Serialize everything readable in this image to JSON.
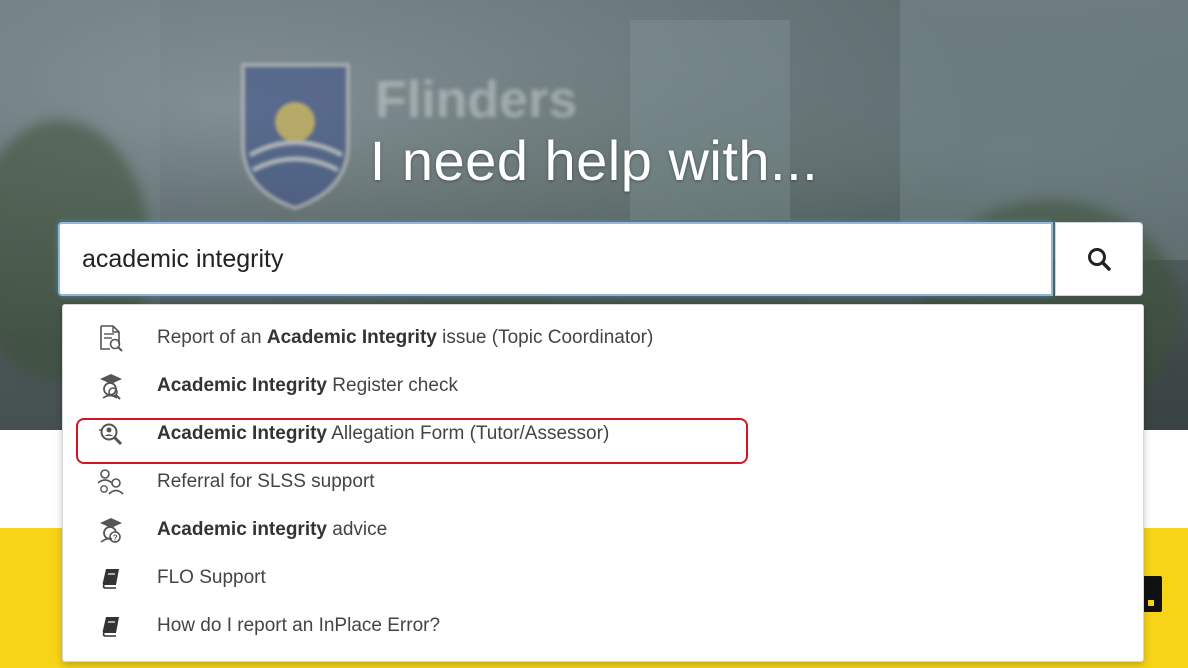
{
  "hero": {
    "headline": "I need help with..."
  },
  "search": {
    "value": "academic integrity",
    "icon": "search-icon"
  },
  "suggestions": [
    {
      "bold": "",
      "pre": "Report of an ",
      "strong": "Academic Integrity",
      "post": " issue (Topic Coordinator)",
      "icon": "document-search-icon"
    },
    {
      "pre": "",
      "strong": "Academic Integrity",
      "post": " Register check",
      "icon": "graduate-search-icon"
    },
    {
      "pre": "",
      "strong": "Academic Integrity",
      "post": " Allegation Form (Tutor/Assessor)",
      "icon": "magnifier-person-icon"
    },
    {
      "pre": "Referral for SLSS support",
      "strong": "",
      "post": "",
      "icon": "people-group-icon"
    },
    {
      "pre": "",
      "strong": "Academic integrity",
      "post": " advice",
      "icon": "graduate-question-icon"
    },
    {
      "pre": "FLO Support",
      "strong": "",
      "post": "",
      "icon": "book-icon"
    },
    {
      "pre": "How do I report an InPlace Error?",
      "strong": "",
      "post": "",
      "icon": "book-icon"
    }
  ],
  "colors": {
    "highlight": "#d5151f",
    "band": "#f7d417",
    "focus": "#8fb8dc"
  }
}
